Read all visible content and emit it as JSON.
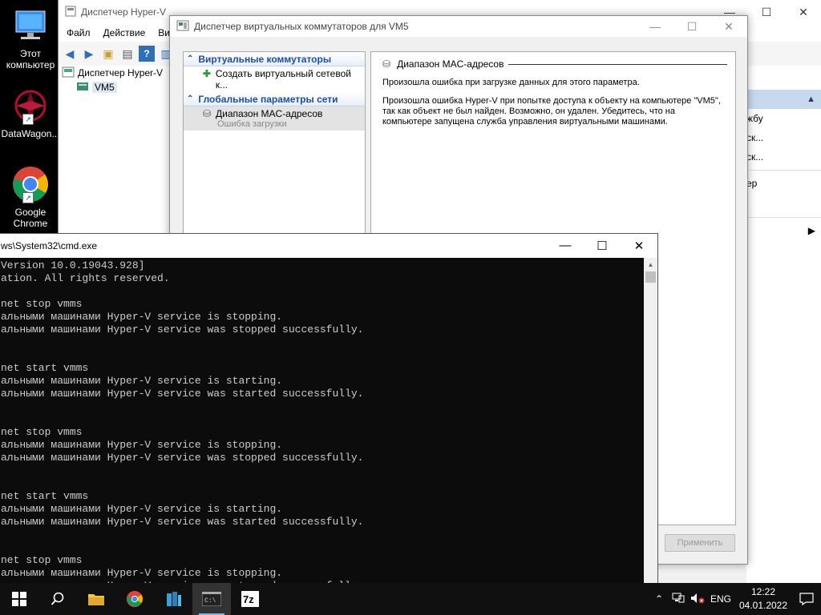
{
  "desktop": {
    "icons": [
      {
        "label_line1": "Этот",
        "label_line2": "компьютер",
        "icon": "computer-icon"
      },
      {
        "label_line1": "DataWagon...",
        "label_line2": "",
        "icon": "datawagon-icon"
      },
      {
        "label_line1": "Google",
        "label_line2": "Chrome",
        "icon": "chrome-icon"
      }
    ]
  },
  "hyperv": {
    "title": "Диспетчер Hyper-V",
    "menu": [
      "Файл",
      "Действие",
      "Вид"
    ],
    "tree_root": "Диспетчер Hyper-V",
    "tree_child": "VM5",
    "actions": [
      "жбу",
      "ск...",
      "ск...",
      "ер"
    ]
  },
  "switch_manager": {
    "title": "Диспетчер виртуальных коммутаторов для VM5",
    "section_virtual": "Виртуальные коммутаторы",
    "create_item": "Создать виртуальный сетевой к...",
    "section_global": "Глобальные параметры сети",
    "mac_item": "Диапазон MAC-адресов",
    "mac_item_sub": "Ошибка загрузки",
    "right_header": "Диапазон MAC-адресов",
    "error_line1": "Произошла ошибка при загрузке данных для этого параметра.",
    "error_line2": "Произошла ошибка Hyper-V при попытке доступа к объекту на компьютере \"VM5\", так как объект не был найден. Возможно, он удален. Убедитесь, что на компьютере запущена служба управления виртуальными машинами.",
    "apply_label": "Применить"
  },
  "cmd": {
    "title": "ws\\System32\\cmd.exe",
    "lines": [
      "Version 10.0.19043.928]",
      "ation. All rights reserved.",
      "",
      "net stop vmms",
      "альными машинами Hyper-V service is stopping.",
      "альными машинами Hyper-V service was stopped successfully.",
      "",
      "",
      "net start vmms",
      "альными машинами Hyper-V service is starting.",
      "альными машинами Hyper-V service was started successfully.",
      "",
      "",
      "net stop vmms",
      "альными машинами Hyper-V service is stopping.",
      "альными машинами Hyper-V service was stopped successfully.",
      "",
      "",
      "net start vmms",
      "альными машинами Hyper-V service is starting.",
      "альными машинами Hyper-V service was started successfully.",
      "",
      "",
      "net stop vmms",
      "альными машинами Hyper-V service is stopping.",
      "альными машинами Hyper-V service was stopped successfully."
    ]
  },
  "taskbar": {
    "language": "ENG",
    "time": "12:22",
    "date": "04.01.2022"
  }
}
